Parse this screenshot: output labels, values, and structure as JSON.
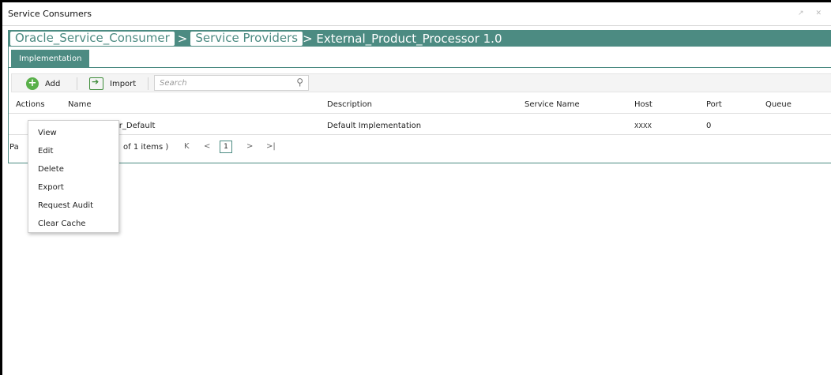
{
  "window": {
    "title": "Service Consumers",
    "controls": "↗ ✕"
  },
  "breadcrumb": {
    "item1": "Oracle_Service_Consumer",
    "sep1": ">",
    "item2": "Service Providers",
    "item3": "> External_Product_Processor 1.0"
  },
  "tabs": [
    {
      "label": "Implementation"
    }
  ],
  "toolbar": {
    "add_label": "Add",
    "import_label": "Import",
    "search_placeholder": "Search"
  },
  "table": {
    "headers": [
      "Actions",
      "Name",
      "Description",
      "Service Name",
      "Host",
      "Port",
      "Queue"
    ],
    "rows": [
      {
        "actions": "",
        "name": "uct_Processor_Default",
        "description": "Default Implementation",
        "service_name": "",
        "host": "XXXX",
        "port": "0",
        "queue": ""
      }
    ]
  },
  "pager": {
    "label": "Pa",
    "items_text": "of 1 items )",
    "first": "K",
    "prev": "<",
    "page": "1",
    "next": ">",
    "last": ">|"
  },
  "context_menu": {
    "items": [
      "View",
      "Edit",
      "Delete",
      "Export",
      "Request Audit",
      "Clear Cache"
    ]
  },
  "colors": {
    "accent": "#4c8b82",
    "add_icon": "#59b04a"
  }
}
